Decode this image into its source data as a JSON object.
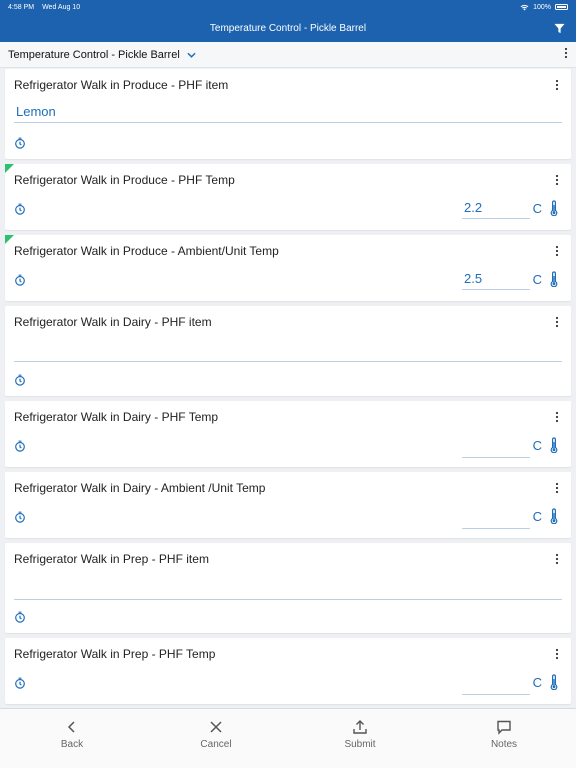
{
  "status_bar": {
    "time": "4:58 PM",
    "date": "Wed Aug 10",
    "battery": "100%"
  },
  "navbar": {
    "title": "Temperature Control - Pickle Barrel"
  },
  "sub_header": {
    "label": "Temperature Control - Pickle Barrel"
  },
  "cards": [
    {
      "title": "Refrigerator Walk in Produce - PHF item",
      "value": "Lemon"
    },
    {
      "title": "Refrigerator Walk in Produce - PHF Temp",
      "value": "2.2",
      "unit": "C"
    },
    {
      "title": "Refrigerator Walk in Produce - Ambient/Unit Temp",
      "value": "2.5",
      "unit": "C"
    },
    {
      "title": "Refrigerator Walk in Dairy - PHF item",
      "value": ""
    },
    {
      "title": "Refrigerator Walk in Dairy - PHF Temp",
      "value": "",
      "unit": "C"
    },
    {
      "title": "Refrigerator Walk in Dairy - Ambient /Unit Temp",
      "value": "",
      "unit": "C"
    },
    {
      "title": "Refrigerator Walk in Prep - PHF item",
      "value": ""
    },
    {
      "title": "Refrigerator Walk in Prep - PHF Temp",
      "value": "",
      "unit": "C"
    }
  ],
  "toolbar": {
    "back": "Back",
    "cancel": "Cancel",
    "submit": "Submit",
    "notes": "Notes"
  },
  "colors": {
    "brand": "#1d62ae",
    "accent": "#1f6eb9",
    "flag": "#2fbf71"
  },
  "icons": [
    "filter-icon",
    "chevron-down-icon",
    "more-icon",
    "timer-icon",
    "thermometer-icon",
    "back-icon",
    "close-icon",
    "upload-icon",
    "notes-icon",
    "wifi-icon",
    "battery-icon"
  ]
}
